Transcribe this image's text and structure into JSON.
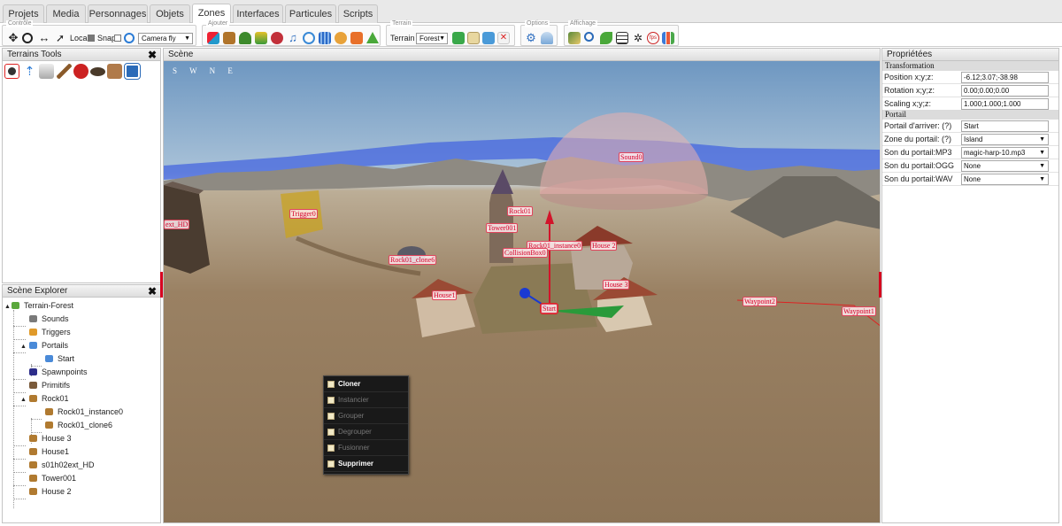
{
  "tabs": [
    "Projets",
    "Media",
    "Personnages",
    "Objets",
    "Zones",
    "Interfaces",
    "Particules",
    "Scripts"
  ],
  "active_tab": "Zones",
  "toolbar": {
    "controles": {
      "label": "Contrôle",
      "local_label": "Local",
      "snap_label": "Snap",
      "camera": "Camera fly",
      "icons": [
        "move-arrows-icon",
        "rotate-icon",
        "scale-arrows-icon",
        "select-cursor-icon",
        "target-icon"
      ]
    },
    "ajouter": {
      "label": "Ajouter",
      "icons": [
        "cubes-icon",
        "crate-icon",
        "tree-icon",
        "flowers-icon",
        "ball-icon",
        "music-note-icon",
        "portal-icon",
        "water-icon",
        "cookie-icon",
        "trigger-icon",
        "mountain-icon"
      ]
    },
    "terrain": {
      "label": "Terrain",
      "name_label": "Terrain :",
      "value": "Forest",
      "icons": [
        "add-terrain-icon",
        "edit-terrain-icon",
        "copy-terrain-icon",
        "delete-terrain-icon"
      ]
    },
    "options": {
      "label": "Options",
      "icons": [
        "settings-gear-icon",
        "weather-icon"
      ]
    },
    "affichage": {
      "label": "Affichage",
      "icons": [
        "layers-icon",
        "zoom-icon",
        "leaf-icon",
        "grid-icon",
        "bug-icon",
        "fps-icon",
        "stats-icon"
      ]
    }
  },
  "terrain_tools": {
    "title": "Terrains Tools",
    "tools": [
      "brush-icon",
      "raise-icon",
      "smooth-icon",
      "paint-icon",
      "flatten-icon",
      "rock-icon",
      "texture-icon",
      "save-icon"
    ]
  },
  "scene_explorer": {
    "title": "Scène Explorer",
    "items": [
      {
        "label": "Terrain-Forest",
        "depth": 0,
        "icon": "#5aa83c"
      },
      {
        "label": "Sounds",
        "depth": 1,
        "icon": "#7a7a7a"
      },
      {
        "label": "Triggers",
        "depth": 1,
        "icon": "#e09a2a"
      },
      {
        "label": "Portails",
        "depth": 1,
        "icon": "#4a8ad8"
      },
      {
        "label": "Start",
        "depth": 2,
        "icon": "#4a8ad8"
      },
      {
        "label": "Spawnpoints",
        "depth": 1,
        "icon": "#2d2d8a"
      },
      {
        "label": "Primitifs",
        "depth": 1,
        "icon": "#7a5a3a"
      },
      {
        "label": "Rock01",
        "depth": 1,
        "icon": "#b07a30"
      },
      {
        "label": "Rock01_instance0",
        "depth": 2,
        "icon": "#b07a30"
      },
      {
        "label": "Rock01_clone6",
        "depth": 2,
        "icon": "#b07a30"
      },
      {
        "label": "House 3",
        "depth": 1,
        "icon": "#b07a30"
      },
      {
        "label": "House1",
        "depth": 1,
        "icon": "#b07a30"
      },
      {
        "label": "s01h02ext_HD",
        "depth": 1,
        "icon": "#b07a30"
      },
      {
        "label": "Tower001",
        "depth": 1,
        "icon": "#b07a30"
      },
      {
        "label": "House 2",
        "depth": 1,
        "icon": "#b07a30"
      }
    ]
  },
  "scene": {
    "title": "Scène",
    "compass": "S W N E",
    "labels": [
      "Sound0",
      "Trigger0",
      "Rock01",
      "Tower001",
      "Rock01_instance0",
      "CollisionBox0",
      "House 2",
      "Rock01_clone6",
      "House1",
      "House 3",
      "Start",
      "Waypoint2",
      "Waypoint1",
      "ext_HD"
    ]
  },
  "context_menu": [
    {
      "label": "Cloner",
      "enabled": true
    },
    {
      "label": "Instancier",
      "enabled": false
    },
    {
      "label": "Grouper",
      "enabled": false
    },
    {
      "label": "Degrouper",
      "enabled": false
    },
    {
      "label": "Fusionner",
      "enabled": false
    },
    {
      "label": "Supprimer",
      "enabled": true
    }
  ],
  "properties": {
    "title": "Propriétées",
    "transformation": {
      "label": "Transformation",
      "position_label": "Position x;y;z:",
      "position": "-6.12;3.07;-38.98",
      "rotation_label": "Rotation x;y;z:",
      "rotation": "0.00;0.00;0.00",
      "scaling_label": "Scaling x;y;z:",
      "scaling": "1.000;1.000;1.000"
    },
    "portail": {
      "label": "Portail",
      "arriver_label": "Portail d'arriver: (?)",
      "arriver": "Start",
      "zone_label": "Zone du portail: (?)",
      "zone": "Island",
      "mp3_label": "Son du portail:MP3",
      "mp3": "magic-harp-10.mp3",
      "ogg_label": "Son du portail:OGG",
      "ogg": "None",
      "wav_label": "Son du portail:WAV",
      "wav": "None"
    }
  },
  "colors": {
    "accent": "#d7001f",
    "label_red": "#d6002a"
  }
}
